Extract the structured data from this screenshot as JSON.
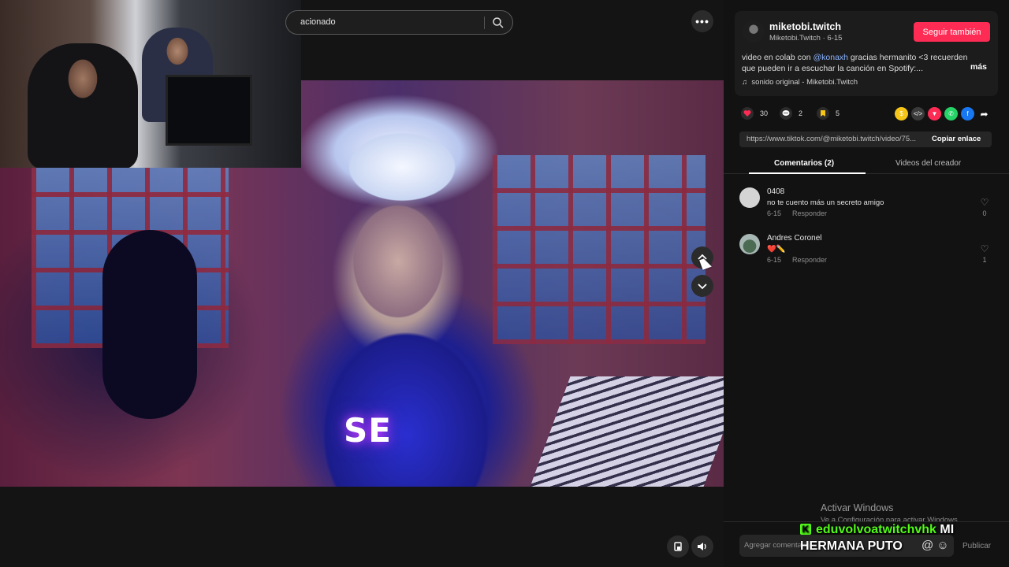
{
  "search": {
    "value": "acionado"
  },
  "video": {
    "caption": "SE"
  },
  "header_more": "•••",
  "nav": {
    "up": "⌃",
    "down": "⌄"
  },
  "author": {
    "username": "miketobi.twitch",
    "display_name": "Miketobi.Twitch",
    "date": "6-15",
    "follow_label": "Seguir también"
  },
  "description": {
    "part1": "video en colab con ",
    "mention": "@konaxh",
    "part2": " gracias hermanito <3 recuerden que pueden ir a escuchar la canción en Spotify:...",
    "more": "más"
  },
  "sound": "sonido original - Miketobi.Twitch",
  "stats": {
    "likes": "30",
    "comments": "2",
    "saves": "5"
  },
  "link": {
    "url": "https://www.tiktok.com/@miketobi.twitch/video/75...",
    "copy_label": "Copiar enlace"
  },
  "tabs": {
    "comments": "Comentarios (2)",
    "creator_videos": "Videos del creador"
  },
  "comments": [
    {
      "name": "0408",
      "text": "no te cuento más un secreto amigo",
      "date": "6-15",
      "reply": "Responder",
      "likes": "0"
    },
    {
      "name": "Andres Coronel",
      "text": "❤️✏️",
      "date": "6-15",
      "reply": "Responder",
      "likes": "1"
    }
  ],
  "comment_input": {
    "placeholder": "Agregar comentario...",
    "publish": "Publicar"
  },
  "windows": {
    "title": "Activar Windows",
    "subtitle": "Ve a Configuración para activar Windows."
  },
  "chat": {
    "user": "eduvolvoatwitchvhk",
    "message_line1": "MI",
    "message_line2": "HERMANA PUTO"
  },
  "colors": {
    "brand": "#fe2c55",
    "kick": "#53fc18",
    "mention": "#8ab4ff"
  },
  "icons": [
    "search-icon",
    "more-icon",
    "chevron-up-icon",
    "chevron-down-icon",
    "heart-icon",
    "comment-icon",
    "bookmark-icon",
    "share-icon",
    "music-note-icon",
    "mute-icon"
  ]
}
